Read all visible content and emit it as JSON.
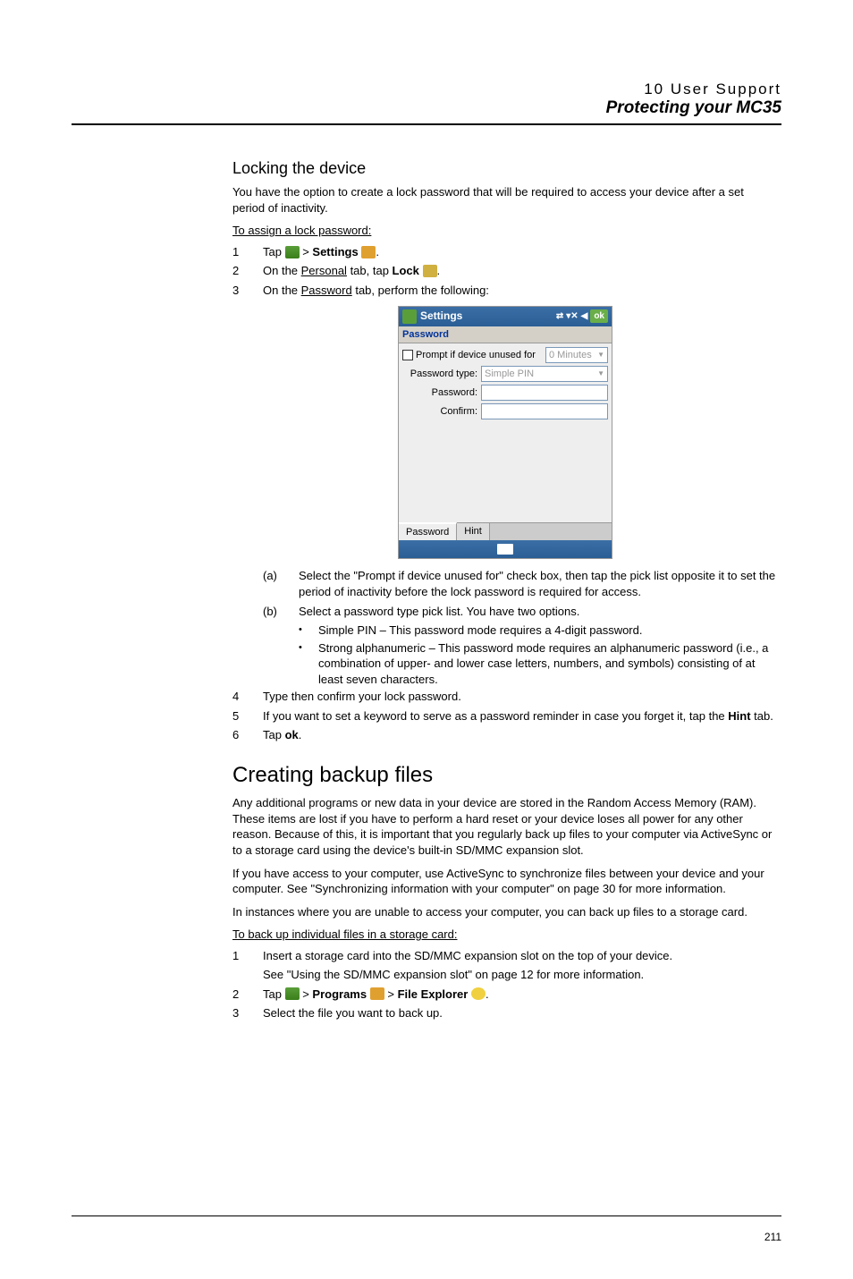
{
  "header": {
    "line1": "10 User Support",
    "line2": "Protecting your MC35"
  },
  "section1": {
    "heading": "Locking the device",
    "intro": "You have the option to create a lock password that will be required to access your device after a set period of inactivity.",
    "proc_head": "To assign a lock password:",
    "step1_num": "1",
    "step1_a": "Tap ",
    "step1_b": " > ",
    "step1_settings": "Settings",
    "step1_c": " ",
    "step1_d": ".",
    "step2_num": "2",
    "step2_a": "On the ",
    "step2_personal": "Personal",
    "step2_b": " tab, tap ",
    "step2_lock": "Lock",
    "step2_c": " ",
    "step2_d": ".",
    "step3_num": "3",
    "step3_a": "On the ",
    "step3_password": "Password",
    "step3_b": " tab, perform the following:",
    "sub_a_num": "(a)",
    "sub_a": "Select the \"Prompt if device unused for\" check box, then tap the pick list opposite it to set the period of inactivity before the lock password is required for access.",
    "sub_b_num": "(b)",
    "sub_b": "Select a password type pick list. You have two options.",
    "bullet1": "Simple PIN – This password mode requires a 4-digit password.",
    "bullet2": "Strong alphanumeric – This password mode requires an alphanumeric password (i.e., a combination of upper- and lower case letters, numbers, and symbols) consisting of at least seven characters.",
    "step4_num": "4",
    "step4": "Type then confirm your lock password.",
    "step5_num": "5",
    "step5_a": "If you want to set a keyword to serve as a password reminder in case you forget it, tap the ",
    "step5_hint": "Hint",
    "step5_b": " tab.",
    "step6_num": "6",
    "step6_a": "Tap ",
    "step6_ok": "ok",
    "step6_b": "."
  },
  "screenshot": {
    "title": "Settings",
    "ok": "ok",
    "menu": "Password",
    "prompt_label": "Prompt if device unused for",
    "prompt_val": "0 Minutes",
    "ptype_label": "Password type:",
    "ptype_val": "Simple PIN",
    "pass_label": "Password:",
    "conf_label": "Confirm:",
    "tab1": "Password",
    "tab2": "Hint"
  },
  "section2": {
    "heading": "Creating backup files",
    "para1": "Any additional programs or new data in your device are stored in the Random Access Memory (RAM). These items are lost if you have to perform a hard reset or your device loses all power for any other reason. Because of this, it is important that you regularly back up files to your computer via ActiveSync or to a storage card using the device's built-in SD/MMC expansion slot.",
    "para2": "If you have access to your computer, use ActiveSync to synchronize files between your device and your computer. See \"Synchronizing information with your computer\" on page 30 for more information.",
    "para3": "In instances where you are unable to access your computer, you can back up files to a storage card.",
    "proc_head": "To back up individual files in a storage card:",
    "step1_num": "1",
    "step1_a": "Insert a storage card into the SD/MMC expansion slot on the top of your device.",
    "step1_b": "See \"Using the SD/MMC expansion slot\" on page 12 for more information.",
    "step2_num": "2",
    "step2_a": "Tap ",
    "step2_b": " > ",
    "step2_programs": "Programs",
    "step2_c": " ",
    "step2_d": " > ",
    "step2_fe": "File Explorer",
    "step2_e": " ",
    "step2_f": ".",
    "step3_num": "3",
    "step3": "Select the file you want to back up."
  },
  "page_num": "211"
}
